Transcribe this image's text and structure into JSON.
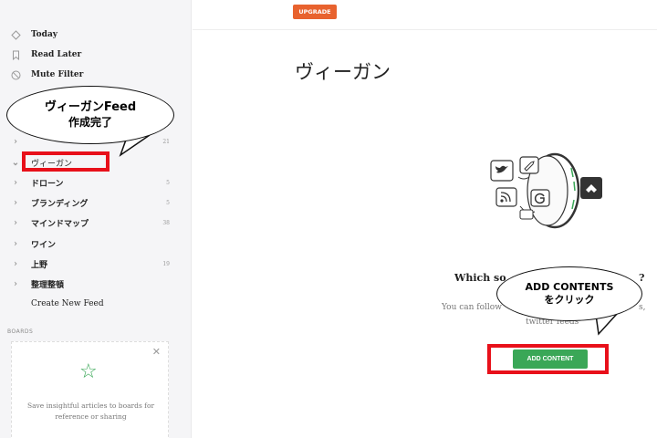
{
  "sidebar": {
    "nav": [
      {
        "label": "Today",
        "icon": "today-icon"
      },
      {
        "label": "Read Later",
        "icon": "bookmark-icon"
      },
      {
        "label": "Mute Filter",
        "icon": "mute-icon"
      }
    ],
    "feeds": [
      {
        "label": "ヴィーガン",
        "count": "",
        "expanded": true
      },
      {
        "label": "ドローン",
        "count": "5"
      },
      {
        "label": "ブランディング",
        "count": "5"
      },
      {
        "label": "マインドマップ",
        "count": "38"
      },
      {
        "label": "ワイン",
        "count": ""
      },
      {
        "label": "上野",
        "count": "19"
      },
      {
        "label": "整理整頓",
        "count": ""
      }
    ],
    "hidden_feed_count": "21",
    "create_feed_label": "Create New Feed",
    "boards_label": "BOARDS",
    "boards_text": "Save insightful articles to boards for reference or sharing"
  },
  "topbar": {
    "upgrade_label": "UPGRADE"
  },
  "main": {
    "title": "ヴィーガン",
    "question_start": "Which so",
    "question_end": "?",
    "follow_start": "You can follow",
    "follow_end": "s,",
    "twitter_feeds": "twitter feeds",
    "add_content_label": "ADD CONTENT"
  },
  "annotations": {
    "bubble1_line1": "ヴィーガンFeed",
    "bubble1_line2": "作成完了",
    "bubble2_line1": "ADD CONTENTS",
    "bubble2_line2": "をクリック"
  },
  "colors": {
    "accent_green": "#3aa757",
    "upgrade_orange": "#e8622e",
    "annotation_red": "#e8101a"
  }
}
